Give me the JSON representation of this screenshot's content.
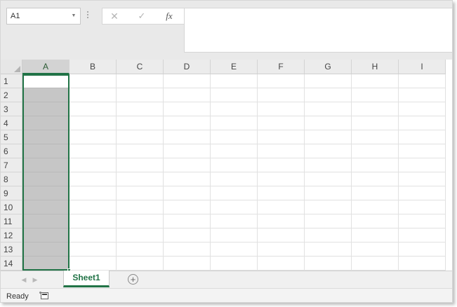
{
  "formula_bar": {
    "name_box_value": "A1",
    "dropdown_glyph": "▼",
    "cancel_glyph": "✕",
    "enter_glyph": "✓",
    "function_glyph": "fx",
    "formula_value": ""
  },
  "grid": {
    "columns": [
      "A",
      "B",
      "C",
      "D",
      "E",
      "F",
      "G",
      "H",
      "I"
    ],
    "rows": [
      "1",
      "2",
      "3",
      "4",
      "5",
      "6",
      "7",
      "8",
      "9",
      "10",
      "11",
      "12",
      "13",
      "14"
    ],
    "selected_column": "A",
    "active_cell": "A1"
  },
  "sheet_tabs": {
    "prev_glyph": "◀",
    "next_glyph": "▶",
    "tabs": [
      {
        "label": "Sheet1",
        "active": true
      }
    ],
    "add_glyph": "+"
  },
  "status_bar": {
    "status": "Ready",
    "icons": [
      "macro-record-icon"
    ]
  },
  "colors": {
    "accent": "#217346",
    "selection_fill": "#c6c6c6",
    "header_fill": "#ececec"
  }
}
